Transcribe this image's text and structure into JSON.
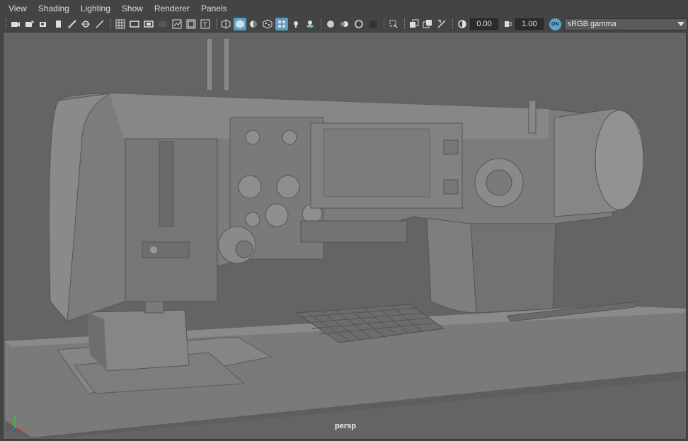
{
  "menubar": {
    "items": [
      "View",
      "Shading",
      "Lighting",
      "Show",
      "Renderer",
      "Panels"
    ]
  },
  "toolbar": {
    "icons": [
      "select-camera-icon",
      "camera-attributes-icon",
      "bookmark-icon",
      "image-plane-icon",
      "grease-pencil-icon",
      "2d-pan-zoom-icon",
      "grid-icon",
      "film-gate-icon",
      "resolution-gate-icon",
      "gate-mask-icon",
      "field-chart-icon",
      "safe-action-icon",
      "safe-title-icon",
      "wireframe-icon",
      "smooth-shade-icon",
      "default-material-icon",
      "textured-icon",
      "wireframe-on-shaded-icon",
      "use-all-lights-icon",
      "shadows-icon",
      "screen-space-ao-icon",
      "motion-blur-icon",
      "multisample-aa-icon",
      "depth-of-field-icon",
      "isolate-select-icon",
      "xray-icon",
      "xray-joints-icon",
      "xray-active-icon",
      "backface-culling-icon",
      "exposure-icon",
      "gamma-icon"
    ],
    "exposure_value": "0.00",
    "gamma_value": "1.00",
    "color_management_badge": "ON",
    "view_transform": "sRGB gamma"
  },
  "viewport": {
    "camera_label": "persp",
    "background_color": "#646464",
    "model_color": "#7c7c7c"
  }
}
